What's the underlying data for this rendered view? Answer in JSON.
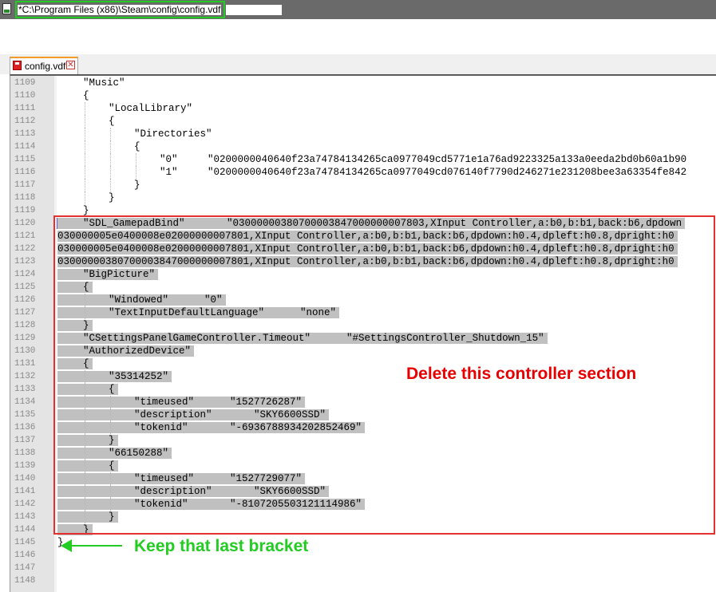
{
  "window": {
    "title": "*C:\\Program Files (x86)\\Steam\\config\\config.vdf",
    "icon": "notepad-icon"
  },
  "tabs": [
    {
      "label": "config.vdf",
      "icon": "floppy-disk-icon",
      "close_icon": "close-icon",
      "close_glyph": "✕"
    }
  ],
  "lines": [
    {
      "n": "1109",
      "indent": 1,
      "text": "\"Music\"",
      "hl": false
    },
    {
      "n": "1110",
      "indent": 1,
      "text": "{",
      "hl": false
    },
    {
      "n": "1111",
      "indent": 2,
      "text": "\"LocalLibrary\"",
      "hl": false
    },
    {
      "n": "1112",
      "indent": 2,
      "text": "{",
      "hl": false
    },
    {
      "n": "1113",
      "indent": 3,
      "text": "\"Directories\"",
      "hl": false
    },
    {
      "n": "1114",
      "indent": 3,
      "text": "{",
      "hl": false
    },
    {
      "n": "1115",
      "indent": 4,
      "text": "\"0\"     \"0200000040640f23a74784134265ca0977049cd5771e1a76ad9223325a133a0eeda2bd0b60a1b90",
      "hl": false
    },
    {
      "n": "1116",
      "indent": 4,
      "text": "\"1\"     \"0200000040640f23a74784134265ca0977049cd076140f7790d246271e231208bee3a63354fe842",
      "hl": false
    },
    {
      "n": "1117",
      "indent": 3,
      "text": "}",
      "hl": false
    },
    {
      "n": "1118",
      "indent": 2,
      "text": "}",
      "hl": false
    },
    {
      "n": "1119",
      "indent": 1,
      "text": "}",
      "hl": false
    },
    {
      "n": "1120",
      "indent": 1,
      "text": "\"SDL_GamepadBind\"       \"03000000380700003847000000007803,XInput Controller,a:b0,b:b1,back:b6,dpdown",
      "hl": true
    },
    {
      "n": "1121",
      "indent": 0,
      "text": "030000005e0400008e02000000007801,XInput Controller,a:b0,b:b1,back:b6,dpdown:h0.4,dpleft:h0.8,dpright:h0",
      "hl": true
    },
    {
      "n": "1122",
      "indent": 0,
      "text": "030000005e0400008e02000000007801,XInput Controller,a:b0,b:b1,back:b6,dpdown:h0.4,dpleft:h0.8,dpright:h0",
      "hl": true
    },
    {
      "n": "1123",
      "indent": 0,
      "text": "03000000380700003847000000007801,XInput Controller,a:b0,b:b1,back:b6,dpdown:h0.4,dpleft:h0.8,dpright:h0",
      "hl": true
    },
    {
      "n": "1124",
      "indent": 1,
      "text": "\"BigPicture\"",
      "hl": true
    },
    {
      "n": "1125",
      "indent": 1,
      "text": "{",
      "hl": true
    },
    {
      "n": "1126",
      "indent": 2,
      "text": "\"Windowed\"      \"0\"",
      "hl": true
    },
    {
      "n": "1127",
      "indent": 2,
      "text": "\"TextInputDefaultLanguage\"      \"none\"",
      "hl": true
    },
    {
      "n": "1128",
      "indent": 1,
      "text": "}",
      "hl": true
    },
    {
      "n": "1129",
      "indent": 1,
      "text": "\"CSettingsPanelGameController.Timeout\"      \"#SettingsController_Shutdown_15\"",
      "hl": true
    },
    {
      "n": "1130",
      "indent": 1,
      "text": "\"AuthorizedDevice\"",
      "hl": true
    },
    {
      "n": "1131",
      "indent": 1,
      "text": "{",
      "hl": true
    },
    {
      "n": "1132",
      "indent": 2,
      "text": "\"35314252\"",
      "hl": true
    },
    {
      "n": "1133",
      "indent": 2,
      "text": "{",
      "hl": true
    },
    {
      "n": "1134",
      "indent": 3,
      "text": "\"timeused\"      \"1527726287\"",
      "hl": true
    },
    {
      "n": "1135",
      "indent": 3,
      "text": "\"description\"       \"SKY6600SSD\"",
      "hl": true
    },
    {
      "n": "1136",
      "indent": 3,
      "text": "\"tokenid\"       \"-6936788934202852469\"",
      "hl": true
    },
    {
      "n": "1137",
      "indent": 2,
      "text": "}",
      "hl": true
    },
    {
      "n": "1138",
      "indent": 2,
      "text": "\"66150288\"",
      "hl": true
    },
    {
      "n": "1139",
      "indent": 2,
      "text": "{",
      "hl": true
    },
    {
      "n": "1140",
      "indent": 3,
      "text": "\"timeused\"      \"1527729077\"",
      "hl": true
    },
    {
      "n": "1141",
      "indent": 3,
      "text": "\"description\"       \"SKY6600SSD\"",
      "hl": true
    },
    {
      "n": "1142",
      "indent": 3,
      "text": "\"tokenid\"       \"-8107205503121114986\"",
      "hl": true
    },
    {
      "n": "1143",
      "indent": 2,
      "text": "}",
      "hl": true
    },
    {
      "n": "1144",
      "indent": 1,
      "text": "}",
      "hl": true
    },
    {
      "n": "1145",
      "indent": 0,
      "text": "}",
      "hl": false
    },
    {
      "n": "1146",
      "indent": 0,
      "text": "",
      "hl": false
    },
    {
      "n": "1147",
      "indent": 0,
      "text": "",
      "hl": false
    },
    {
      "n": "1148",
      "indent": 0,
      "text": "",
      "hl": false
    }
  ],
  "annotations": {
    "delete_note": "Delete this controller section",
    "keep_note": "Keep that last bracket",
    "delete_color": "#e80000",
    "keep_color": "#22cc22"
  }
}
